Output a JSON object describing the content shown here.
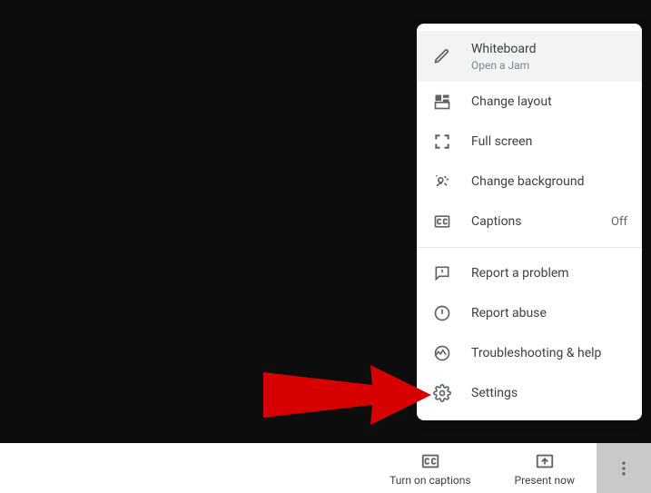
{
  "menu": {
    "whiteboard": {
      "label": "Whiteboard",
      "sub": "Open a Jam"
    },
    "change_layout": {
      "label": "Change layout"
    },
    "full_screen": {
      "label": "Full screen"
    },
    "change_background": {
      "label": "Change background"
    },
    "captions": {
      "label": "Captions",
      "trailing": "Off"
    },
    "report_problem": {
      "label": "Report a problem"
    },
    "report_abuse": {
      "label": "Report abuse"
    },
    "troubleshooting": {
      "label": "Troubleshooting & help"
    },
    "settings": {
      "label": "Settings"
    }
  },
  "bottom": {
    "captions": "Turn on captions",
    "present": "Present now"
  }
}
